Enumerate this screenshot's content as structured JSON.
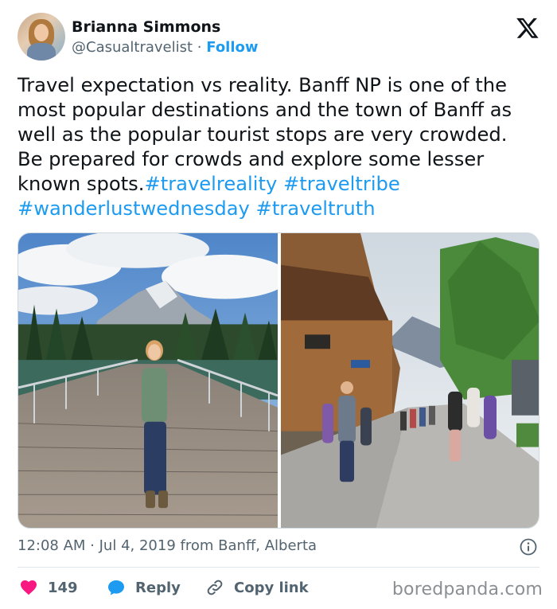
{
  "author": {
    "name": "Brianna Simmons",
    "handle": "@Casualtravelist",
    "separator": " · ",
    "follow_label": "Follow"
  },
  "tweet": {
    "lines": [
      "Travel expectation vs reality. Banff NP is one of the",
      "most popular destinations and the town of Banff as",
      "well as the popular tourist stops are very crowded.",
      "Be prepared for crowds and explore some lesser"
    ],
    "line5_text": "known  spots.",
    "hashtags": [
      "#travelreality",
      "#traveltribe",
      "#wanderlustwednesday",
      "#traveltruth"
    ]
  },
  "meta": {
    "time": "12:08 AM",
    "separator": " · ",
    "date": "Jul 4, 2019",
    "location": " from Banff, Alberta"
  },
  "actions": {
    "like_count": "149",
    "reply_label": "Reply",
    "copy_label": "Copy link"
  },
  "watermark": "boredpanda.com",
  "colors": {
    "link": "#1d9bf0",
    "like": "#f91880",
    "muted": "#536471",
    "text": "#0f1419"
  },
  "icons": {
    "logo": "x-logo-icon",
    "info": "info-icon",
    "like": "heart-icon",
    "reply": "speech-bubble-icon",
    "copy": "link-icon"
  }
}
